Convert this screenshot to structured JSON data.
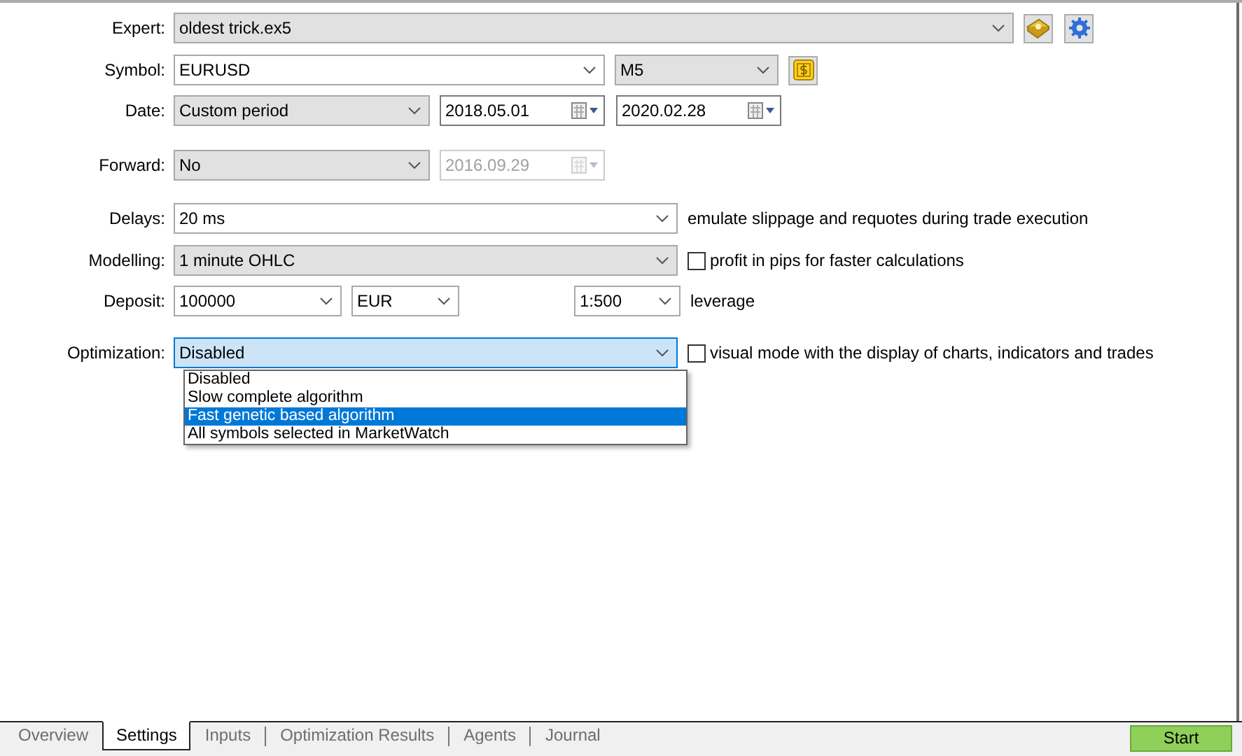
{
  "rows": [
    {
      "label": "Expert:",
      "controls": [
        {
          "kind": "combo",
          "value": "oldest trick.ex5",
          "editable": false
        },
        {
          "kind": "book-button"
        },
        {
          "kind": "gear-button"
        }
      ]
    },
    {
      "label": "Symbol:",
      "controls": [
        {
          "kind": "combo",
          "value": "EURUSD",
          "editable": true
        },
        {
          "kind": "combo",
          "value": "M5",
          "editable": false
        },
        {
          "kind": "dollar-button"
        }
      ]
    },
    {
      "label": "Date:",
      "controls": [
        {
          "kind": "combo",
          "value": "Custom period",
          "editable": false
        },
        {
          "kind": "date",
          "value": "2018.05.01",
          "disabled": false
        },
        {
          "kind": "date",
          "value": "2020.02.28",
          "disabled": false
        }
      ]
    },
    {
      "label": "Forward:",
      "controls": [
        {
          "kind": "combo",
          "value": "No",
          "editable": false
        },
        {
          "kind": "date",
          "value": "2016.09.29",
          "disabled": true
        }
      ]
    },
    {
      "label": "Delays:",
      "controls": [
        {
          "kind": "combo",
          "value": "20 ms",
          "editable": true
        },
        {
          "kind": "note",
          "text": "emulate slippage and requotes during trade execution"
        }
      ]
    },
    {
      "label": "Modelling:",
      "controls": [
        {
          "kind": "combo",
          "value": "1 minute OHLC",
          "editable": false
        },
        {
          "kind": "checkbox",
          "text": "profit in pips for faster calculations",
          "checked": false
        }
      ]
    },
    {
      "label": "Deposit:",
      "controls": [
        {
          "kind": "combo",
          "value": "100000",
          "editable": true
        },
        {
          "kind": "combo",
          "value": "EUR",
          "editable": true
        },
        {
          "kind": "combo",
          "value": "1:500",
          "editable": true
        },
        {
          "kind": "note",
          "text": "leverage"
        }
      ]
    },
    {
      "label": "Optimization:",
      "controls": [
        {
          "kind": "combo",
          "value": "Disabled",
          "editable": false,
          "focused": true
        },
        {
          "kind": "checkbox",
          "text": "visual mode with the display of charts, indicators and trades",
          "checked": false
        }
      ]
    }
  ],
  "dropdown": {
    "options": [
      {
        "label": "Disabled",
        "selected": false
      },
      {
        "label": "Slow complete algorithm",
        "selected": false
      },
      {
        "label": "Fast genetic based algorithm",
        "selected": true
      },
      {
        "label": "All symbols selected in MarketWatch",
        "selected": false
      }
    ]
  },
  "tabs": [
    {
      "label": "Overview",
      "selected": false
    },
    {
      "label": "Settings",
      "selected": true
    },
    {
      "label": "Inputs",
      "selected": false
    },
    {
      "label": "Optimization Results",
      "selected": false
    },
    {
      "label": "Agents",
      "selected": false
    },
    {
      "label": "Journal",
      "selected": false
    }
  ],
  "start_button": "Start"
}
